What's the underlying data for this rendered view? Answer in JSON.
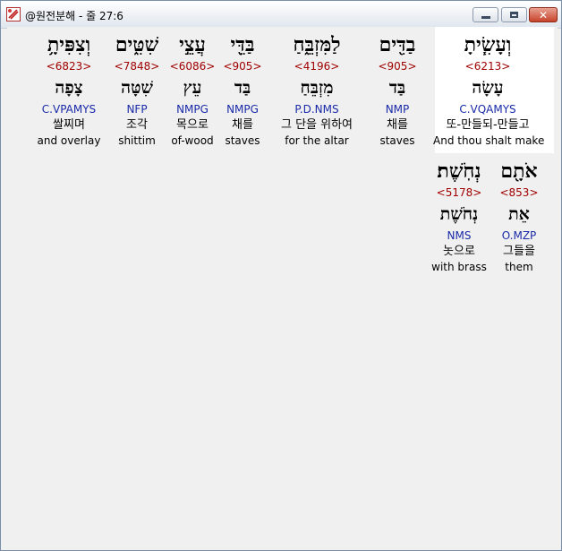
{
  "window": {
    "title": "@원전분해 - 줄 27:6"
  },
  "words": [
    {
      "hebrew": "וְעָשִׂ֧יתָ",
      "strong": "<6213>",
      "root": "עָשָׂה",
      "morph": "C.VQAMYS",
      "korean": "또-만들되-만들고",
      "english": "And thou shalt make"
    },
    {
      "hebrew": "בַדִּ֖ים",
      "strong": "<905>",
      "root": "בַּד",
      "morph": "NMP",
      "korean": "채를",
      "english": "staves"
    },
    {
      "hebrew": "לַמִּזְבֵּ֑חַ",
      "strong": "<4196>",
      "root": "מִזְבֵּחַ",
      "morph": "P.D.NMS",
      "korean": "그 단을 위하여",
      "english": "for the altar"
    },
    {
      "hebrew": "בַּדֵּ֖י",
      "strong": "<905>",
      "root": "בַּד",
      "morph": "NMPG",
      "korean": "채를",
      "english": "staves"
    },
    {
      "hebrew": "עֲצֵ֣י",
      "strong": "<6086>",
      "root": "עֵץ",
      "morph": "NMPG",
      "korean": "목으로",
      "english": "of-wood"
    },
    {
      "hebrew": "שִׁטִּ֑ים",
      "strong": "<7848>",
      "root": "שִׁטָּה",
      "morph": "NFP",
      "korean": "조각",
      "english": "shittim"
    },
    {
      "hebrew": "וְצִפִּיתָ֥",
      "strong": "<6823>",
      "root": "צָפָה",
      "morph": "C.VPAMYS",
      "korean": "쌀찌며",
      "english": "and overlay"
    },
    {
      "hebrew": "אֹתָ֖ם",
      "strong": "<853>",
      "root": "אֵת",
      "morph": "O.MZP",
      "korean": "그들을",
      "english": "them"
    },
    {
      "hebrew": "נְחֹֽשֶׁת׃",
      "strong": "<5178>",
      "root": "נְחֹשֶׁת",
      "morph": "NMS",
      "korean": "놋으로",
      "english": "with brass"
    }
  ]
}
